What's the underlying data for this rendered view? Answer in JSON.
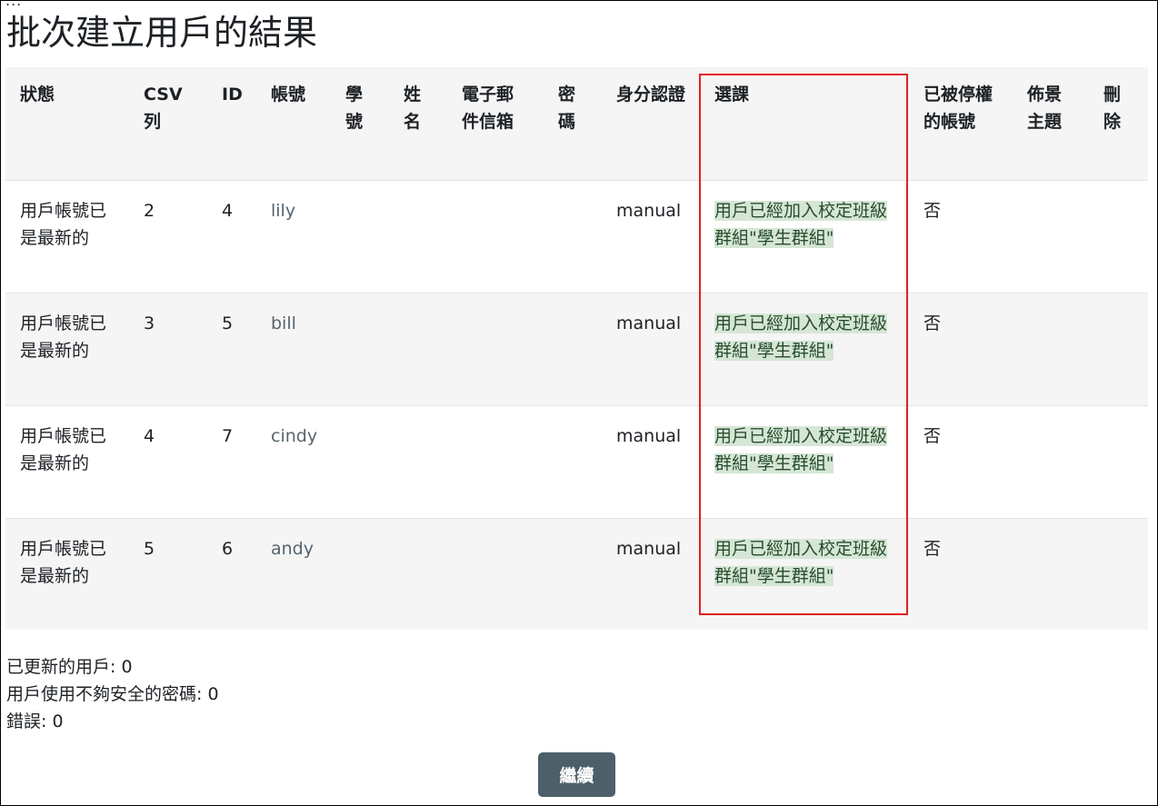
{
  "page": {
    "ellipsis": "...",
    "title": "批次建立用戶的結果"
  },
  "table": {
    "headers": [
      "狀態",
      "CSV列",
      "ID",
      "帳號",
      "學號",
      "姓名",
      "電子郵件信箱",
      "密碼",
      "身分認證",
      "選課",
      "已被停權的帳號",
      "佈景主題",
      "刪除"
    ],
    "rows": [
      {
        "status": "用戶帳號已是最新的",
        "csv_row": "2",
        "id": "4",
        "username": "lily",
        "auth": "manual",
        "enrolment": "用戶已經加入校定班級群組\"學生群組\"",
        "suspended": "否"
      },
      {
        "status": "用戶帳號已是最新的",
        "csv_row": "3",
        "id": "5",
        "username": "bill",
        "auth": "manual",
        "enrolment": "用戶已經加入校定班級群組\"學生群組\"",
        "suspended": "否"
      },
      {
        "status": "用戶帳號已是最新的",
        "csv_row": "4",
        "id": "7",
        "username": "cindy",
        "auth": "manual",
        "enrolment": "用戶已經加入校定班級群組\"學生群組\"",
        "suspended": "否"
      },
      {
        "status": "用戶帳號已是最新的",
        "csv_row": "5",
        "id": "6",
        "username": "andy",
        "auth": "manual",
        "enrolment": "用戶已經加入校定班級群組\"學生群組\"",
        "suspended": "否"
      }
    ]
  },
  "summary": {
    "updated": "已更新的用戶: 0",
    "weak_password": "用戶使用不夠安全的密碼: 0",
    "errors": "錯誤: 0"
  },
  "buttons": {
    "continue": "繼續"
  },
  "colors": {
    "highlight_border": "#e02020",
    "button_bg": "#4d5f69",
    "note_bg": "#d6e6d6"
  }
}
